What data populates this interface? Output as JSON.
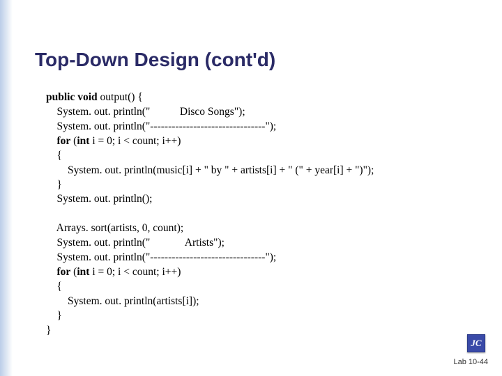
{
  "title": "Top-Down Design (cont'd)",
  "code": {
    "l1a": "public void",
    "l1b": " output() {",
    "l2": "    System. out. println(\"           Disco Songs\");",
    "l3": "    System. out. println(\"--------------------------------\");",
    "l4a": "    for",
    "l4b": " (",
    "l4c": "int",
    "l4d": " i = 0; i < count; i++)",
    "l5": "    {",
    "l6": "        System. out. println(music[i] + \" by \" + artists[i] + \" (\" + year[i] + \")\");",
    "l7": "    }",
    "l8": "    System. out. println();",
    "blank1": "",
    "l9": "    Arrays. sort(artists, 0, count);",
    "l10": "    System. out. println(\"             Artists\");",
    "l11": "    System. out. println(\"--------------------------------\");",
    "l12a": "    for",
    "l12b": " (",
    "l12c": "int",
    "l12d": " i = 0; i < count; i++)",
    "l13": "    {",
    "l14": "        System. out. println(artists[i]);",
    "l15": "    }",
    "l16": "}"
  },
  "logo_text": "JC",
  "footer": "Lab 10-44"
}
